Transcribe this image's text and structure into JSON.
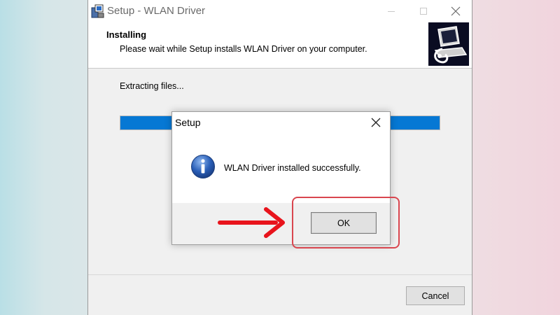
{
  "window": {
    "title": "Setup - WLAN Driver",
    "icon": "setup-installer-icon",
    "controls": {
      "minimize": "minimize-icon",
      "maximize": "maximize-icon",
      "close": "close-icon"
    }
  },
  "header": {
    "title": "Installing",
    "subtitle": "Please wait while Setup installs WLAN Driver on your computer.",
    "logo": "computer-setup-logo"
  },
  "status": {
    "text": "Extracting files...",
    "progress_fraction": 1.0
  },
  "footer": {
    "cancel_label": "Cancel"
  },
  "dialog": {
    "title": "Setup",
    "message": "WLAN Driver installed successfully.",
    "icon": "info-icon",
    "ok_label": "OK"
  },
  "annotation": {
    "highlight_color": "#d9464f",
    "arrow_color": "#e8141c",
    "target": "ok-button"
  },
  "colors": {
    "progress": "#0678d4",
    "info_icon": "#2a5fb8"
  }
}
